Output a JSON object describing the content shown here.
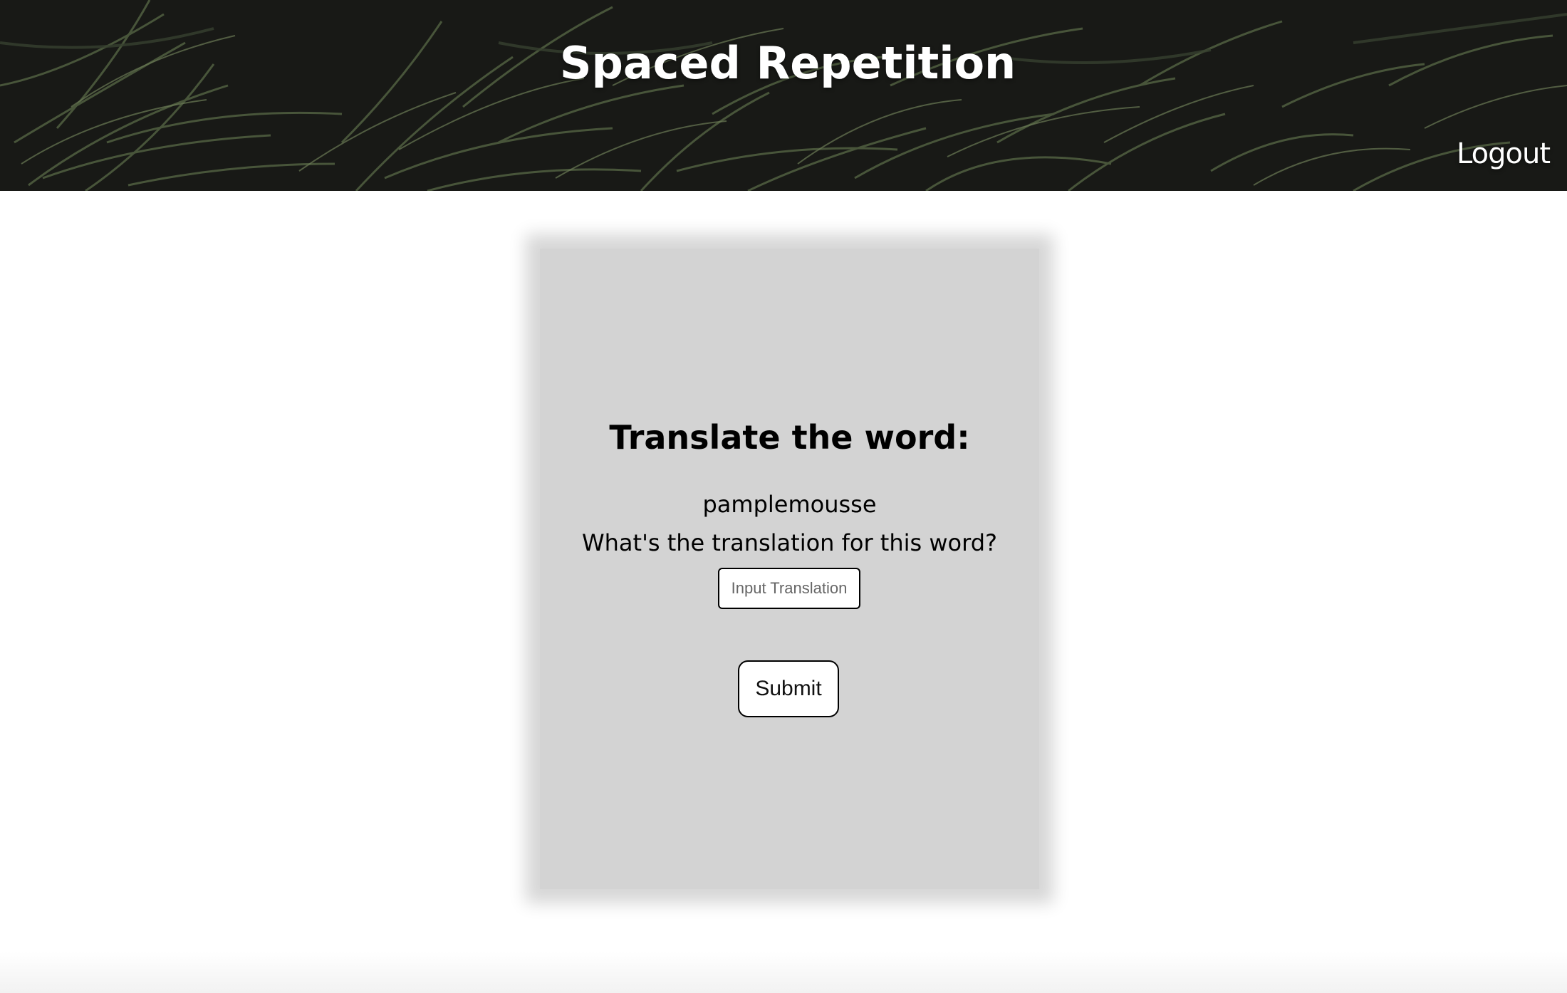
{
  "header": {
    "title": "Spaced Repetition",
    "logout_label": "Logout"
  },
  "card": {
    "heading": "Translate the word:",
    "word": "pamplemousse",
    "question": "What's the translation for this word?",
    "input_placeholder": "Input Translation",
    "input_value": "",
    "submit_label": "Submit"
  },
  "colors": {
    "card_background": "#d3d3d3",
    "header_text": "#ffffff",
    "header_background": "#1c1d1a"
  }
}
